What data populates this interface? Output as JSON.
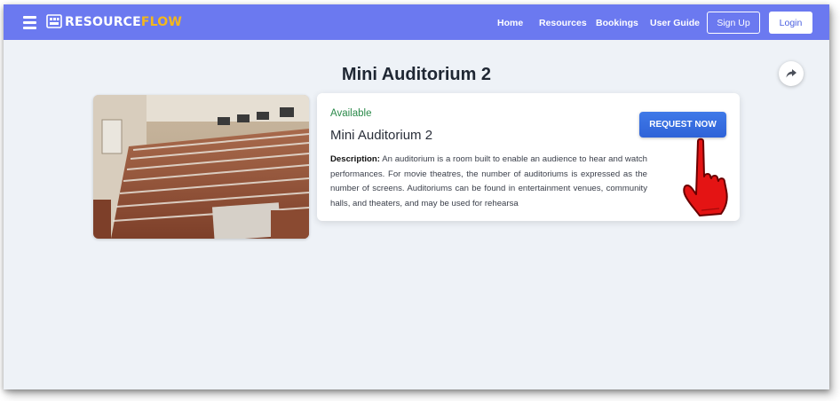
{
  "brand": {
    "part1": "RESOURCE",
    "part2": "FLOW",
    "accent_color": "#f3b71d"
  },
  "nav": {
    "home": "Home",
    "resources": "Resources",
    "bookings": "Bookings",
    "user_guide": "User Guide",
    "sign_up": "Sign Up",
    "login": "Login"
  },
  "page": {
    "title": "Mini Auditorium 2"
  },
  "resource": {
    "status": "Available",
    "name": "Mini Auditorium 2",
    "description_label": "Description:",
    "description_text": " An auditorium is a room built to enable an audience to hear and watch performances. For movie theatres, the number of auditoriums is expressed as the number of screens. Auditoriums can be found in entertainment venues, community halls, and theaters, and may be used for rehearsa",
    "request_button": "REQUEST NOW"
  },
  "icons": {
    "menu": "hamburger-icon",
    "share": "share-arrow-icon",
    "pointer": "pointing-hand-icon"
  },
  "colors": {
    "navbar": "#6b79f0",
    "button": "#3f79e8",
    "status": "#2b8a4a"
  }
}
